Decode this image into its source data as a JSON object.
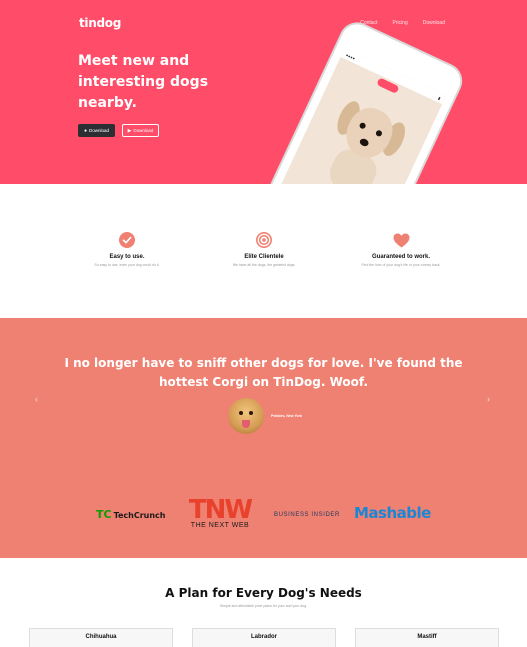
{
  "hero": {
    "brand": "tindog",
    "nav": [
      "Contact",
      "Pricing",
      "Download"
    ],
    "title": "Meet new and interesting dogs nearby.",
    "buttons": {
      "apple": "Download",
      "play": "Download"
    }
  },
  "features": [
    {
      "title": "Easy to use.",
      "text": "So easy to use, even your dog could do it.",
      "icon": "check-circle-icon"
    },
    {
      "title": "Elite Clientele",
      "text": "We have all the dogs, the greatest dogs.",
      "icon": "bullseye-icon"
    },
    {
      "title": "Guaranteed to work.",
      "text": "Find the love of your dog's life or your money back.",
      "icon": "heart-icon"
    }
  ],
  "testimonial": {
    "quote": "I no longer have to sniff other dogs for love. I've found the hottest Corgi on TinDog. Woof.",
    "author": "Pebbles, New York"
  },
  "press": {
    "techcrunch": "TechCrunch",
    "techcrunch_mark": "TC",
    "tnw_big": "TNW",
    "tnw_small": "THE NEXT WEB",
    "business_insider": "BUSINESS INSIDER",
    "mashable": "Mashable"
  },
  "pricing": {
    "title": "A Plan for Every Dog's Needs",
    "subtitle": "Simple and affordable price plans for your and your dog.",
    "plans": [
      "Chihuahua",
      "Labrador",
      "Mastiff"
    ]
  },
  "colors": {
    "hero_bg": "#ff4c68",
    "testimonial_bg": "#ef8172",
    "feature_icon": "#ef8172"
  }
}
